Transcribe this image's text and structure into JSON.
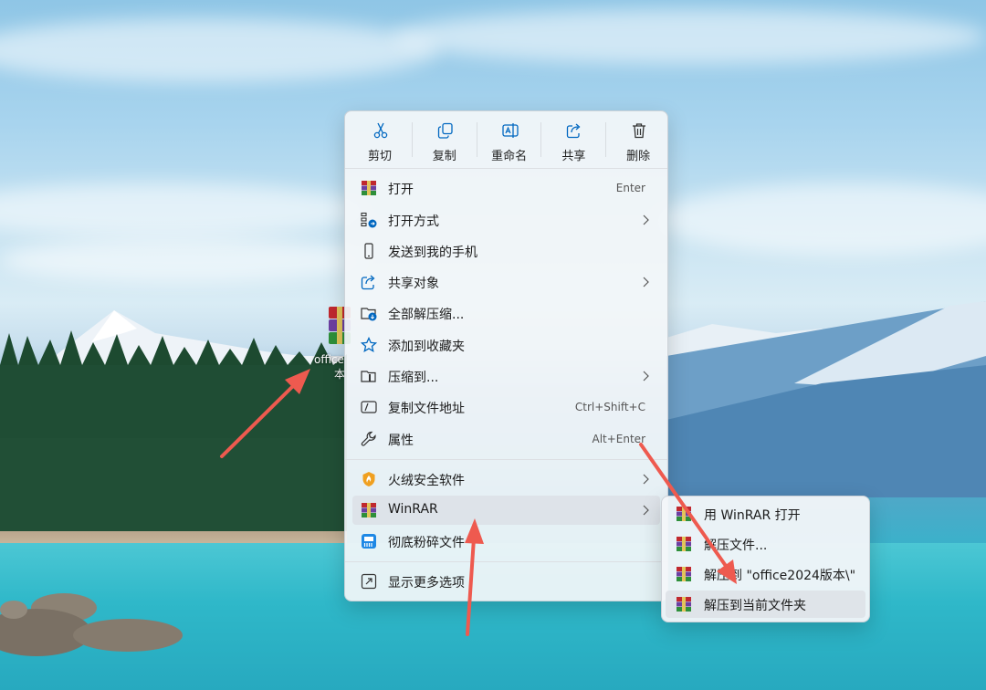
{
  "desktop": {
    "file_label": "office",
    "file_label_line2": "本"
  },
  "toolbar": {
    "cut": "剪切",
    "copy": "复制",
    "rename": "重命名",
    "share": "共享",
    "delete": "删除"
  },
  "menu": {
    "open": "打开",
    "open_shortcut": "Enter",
    "open_with": "打开方式",
    "send_to_phone": "发送到我的手机",
    "share_with": "共享对象",
    "extract_all": "全部解压缩...",
    "add_favorites": "添加到收藏夹",
    "compress_to": "压缩到...",
    "copy_path": "复制文件地址",
    "copy_path_shortcut": "Ctrl+Shift+C",
    "properties": "属性",
    "properties_shortcut": "Alt+Enter",
    "huorong": "火绒安全软件",
    "winrar": "WinRAR",
    "shred": "彻底粉碎文件",
    "more_options": "显示更多选项"
  },
  "submenu": {
    "open_with_winrar": "用 WinRAR 打开",
    "extract_files": "解压文件...",
    "extract_to_folder": "解压到 \"office2024版本\\\"",
    "extract_here": "解压到当前文件夹"
  },
  "colors": {
    "arrow": "#ee5a4f",
    "accent": "#0067c0",
    "rar_red": "#c0282e",
    "rar_purple": "#6c3fa0",
    "rar_green": "#2e8f3a"
  }
}
